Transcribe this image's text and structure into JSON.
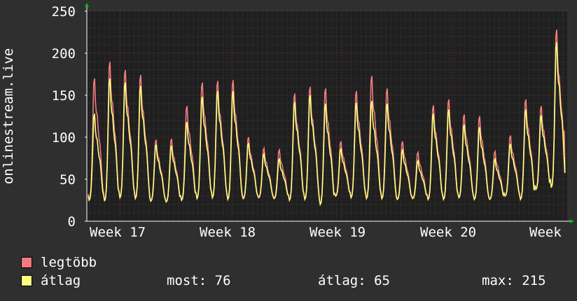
{
  "chart_data": {
    "type": "line",
    "ylabel": "onlinestream.live",
    "yticks": [
      0,
      50,
      100,
      150,
      200,
      250
    ],
    "ylim": [
      0,
      250
    ],
    "xtick_labels": [
      "Week 17",
      "Week 18",
      "Week 19",
      "Week 20",
      "Week"
    ],
    "grid": true,
    "series": [
      {
        "name": "legtöbb",
        "color": "#f07a7e",
        "daily_peaks": [
          170,
          190,
          180,
          174,
          97,
          98,
          137,
          165,
          167,
          168,
          100,
          87,
          85,
          152,
          160,
          158,
          95,
          155,
          173,
          158,
          95,
          82,
          138,
          145,
          127,
          125,
          83,
          102,
          145,
          137,
          228
        ],
        "daily_lows": [
          25,
          24,
          28,
          27,
          24,
          23,
          25,
          27,
          28,
          26,
          27,
          28,
          27,
          25,
          26,
          20,
          30,
          28,
          27,
          27,
          26,
          27,
          26,
          26,
          28,
          26,
          26,
          30,
          26,
          38,
          40
        ],
        "last": 108
      },
      {
        "name": "átlag",
        "color": "#ffff80",
        "daily_peaks": [
          128,
          170,
          165,
          161,
          91,
          90,
          118,
          148,
          155,
          155,
          93,
          80,
          74,
          142,
          150,
          140,
          86,
          141,
          143,
          140,
          85,
          72,
          128,
          133,
          115,
          112,
          74,
          92,
          133,
          126,
          213
        ],
        "daily_lows": [
          25,
          24,
          28,
          27,
          24,
          23,
          25,
          27,
          28,
          26,
          27,
          28,
          27,
          25,
          26,
          20,
          30,
          28,
          27,
          27,
          26,
          27,
          26,
          26,
          28,
          26,
          26,
          30,
          26,
          38,
          40
        ],
        "last": 76
      }
    ]
  },
  "legend": {
    "max_label": "legtöbb",
    "avg_label": "átlag",
    "stat_current": "most: 76",
    "stat_average": "átlag: 65",
    "stat_max": "max: 215"
  },
  "colors": {
    "background": "#2f2f2f",
    "plot_area": "#1f1f1f",
    "grid_minor": "#3c3c3c",
    "grid_major": "#7a2a2a",
    "axis_arrow": "#00c000"
  }
}
